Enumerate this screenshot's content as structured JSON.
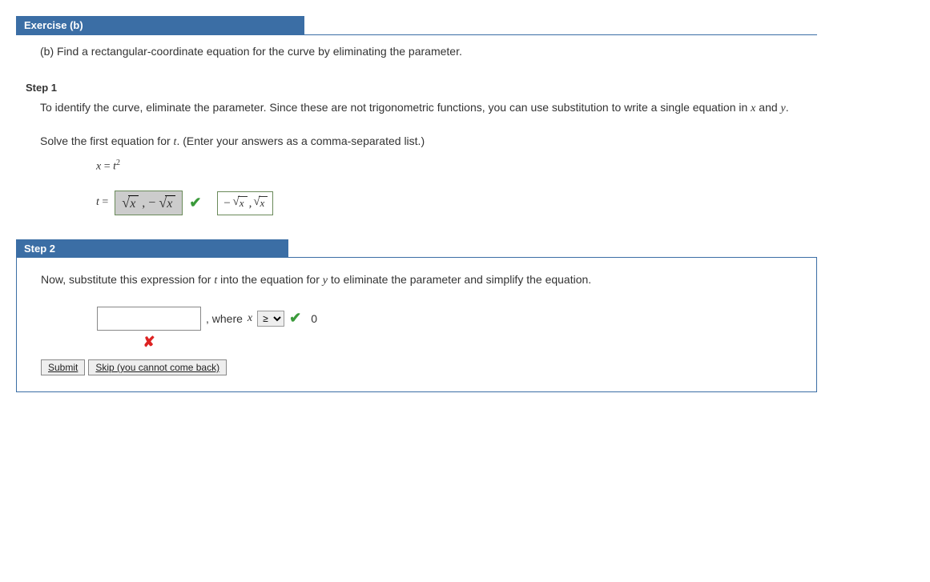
{
  "exercise": {
    "header": "Exercise (b)",
    "prompt": "(b) Find a rectangular-coordinate equation for the curve by eliminating the parameter."
  },
  "step1": {
    "label": "Step 1",
    "p1": "To identify the curve, eliminate the parameter. Since these are not trigonometric functions, you can use substitution to write a single equation in ",
    "p1_m1": "x",
    "p1_mid": " and ",
    "p1_m2": "y",
    "p1_end": ".",
    "p2a": "Solve the first equation for ",
    "p2_m": "t",
    "p2b": ". (Enter your answers as a comma-separated list.)",
    "eq1_lhs": "x",
    "eq1_rhs": "t",
    "eq1_exp": "2",
    "t_label": "t",
    "user_answer_parts": {
      "rad": "x",
      "sep": ", −",
      "rad2": "x"
    },
    "shown_answer": {
      "neg": "−",
      "rad": "x",
      "sep": ", ",
      "rad2": "x"
    }
  },
  "step2": {
    "label": "Step 2",
    "p1a": "Now, substitute this expression for ",
    "p1_m": "t",
    "p1b": " into the equation for ",
    "p1_m2": "y",
    "p1c": " to eliminate the parameter and simplify the equation.",
    "input_value": "",
    "where_pre": ", where ",
    "where_var": "x",
    "select_value": "≥",
    "select_options": [
      "≥",
      "≤",
      "=",
      "<",
      ">"
    ],
    "rhs": "0",
    "submit": "Submit",
    "skip": "Skip (you cannot come back)"
  }
}
